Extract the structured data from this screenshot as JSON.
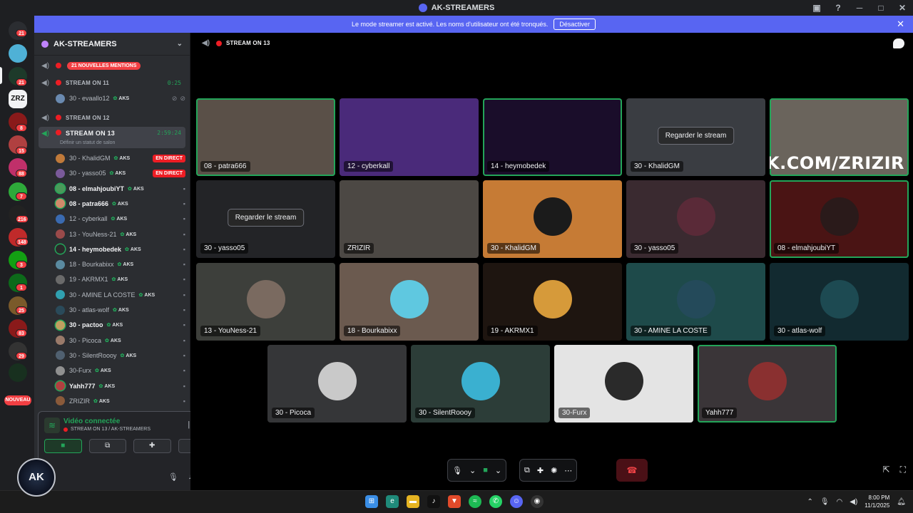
{
  "window": {
    "title": "AK-STREAMERS",
    "controls": [
      "screen-share-icon",
      "help-icon",
      "minimize-icon",
      "maximize-icon",
      "close-icon"
    ]
  },
  "banner": {
    "text": "Le mode streamer est activé. Les noms d'utilisateur ont été tronqués.",
    "button": "Désactiver"
  },
  "rail": {
    "badges": [
      "21",
      "21",
      "8",
      "15",
      "88",
      "7",
      "216",
      "148",
      "3",
      "1",
      "25",
      "83",
      "29"
    ],
    "new_label": "NOUVEAU"
  },
  "server": {
    "name": "AK-STREAMERS"
  },
  "channels": {
    "mentions": "21 NOUVELLES MENTIONS",
    "stream11": {
      "name": "STREAM ON 11",
      "timer": "0:25"
    },
    "stream11_user": {
      "name": "30 - evaallo12",
      "tag": "AKS"
    },
    "stream12": {
      "name": "STREAM ON 12"
    },
    "stream13": {
      "name": "STREAM ON 13",
      "timer": "2:59:24",
      "status": "Définir un statut de salon"
    },
    "live_label": "EN DIRECT",
    "users": [
      {
        "name": "30 - KhalidGM",
        "tag": "AKS",
        "live": true
      },
      {
        "name": "30 - yasso05",
        "tag": "AKS",
        "live": true
      },
      {
        "name": "08 - elmahjoubiYT",
        "tag": "AKS"
      },
      {
        "name": "08 - patra666",
        "tag": "AKS"
      },
      {
        "name": "12 - cyberkall",
        "tag": "AKS"
      },
      {
        "name": "13 - YouNess-21",
        "tag": "AKS"
      },
      {
        "name": "14 - heymobedek",
        "tag": "AKS"
      },
      {
        "name": "18 - Bourkabixx",
        "tag": "AKS"
      },
      {
        "name": "19 - AKRMX1",
        "tag": "AKS"
      },
      {
        "name": "30 - AMINE LA COSTE",
        "tag": "AKS"
      },
      {
        "name": "30 - atlas-wolf",
        "tag": "AKS"
      },
      {
        "name": "30 - pactoo",
        "tag": "AKS"
      },
      {
        "name": "30 - Picoca",
        "tag": "AKS"
      },
      {
        "name": "30 - SilentRoooy",
        "tag": "AKS"
      },
      {
        "name": "30-Furx",
        "tag": "AKS"
      },
      {
        "name": "Yahh777",
        "tag": "AKS"
      },
      {
        "name": "ZRIZIR",
        "tag": "AKS"
      }
    ]
  },
  "voice": {
    "title": "Vidéo connectée",
    "subtitle": "STREAM ON 13 / AK-STREAMERS"
  },
  "logo_text": "AK",
  "stage": {
    "channel": "STREAM ON 13",
    "watch_label": "Regarder le stream",
    "kick_k": "K",
    "kick_rest": "ICK.COM/ZRIZIR",
    "tiles": [
      {
        "label": "08 - patra666",
        "bg": "#5a5048",
        "speaking": true
      },
      {
        "label": "12 - cyberkall",
        "bg": "#4a2a7a",
        "speaking": false
      },
      {
        "label": "14 - heymobedek",
        "bg": "#1a0d2a",
        "speaking": true
      },
      {
        "label": "30 - KhalidGM",
        "bg": "#3a3d42",
        "speaking": false,
        "stream": true
      },
      {
        "label": "",
        "bg": "#6a645c",
        "speaking": true,
        "kick": true
      },
      {
        "label": "30 - yasso05",
        "bg": "#232427",
        "speaking": false,
        "stream": true
      },
      {
        "label": "ZRIZIR",
        "bg": "#4c4844",
        "speaking": false
      },
      {
        "label": "30 - KhalidGM",
        "bg": "#c67b35",
        "speaking": false,
        "avatar": "#1b1b1b"
      },
      {
        "label": "30 - yasso05",
        "bg": "#3a2a30",
        "speaking": false,
        "avatar": "#5a2a38"
      },
      {
        "label": "08 - elmahjoubiYT",
        "bg": "#4a1414",
        "speaking": true,
        "avatar": "#2a1a1a"
      },
      {
        "label": "13 - YouNess-21",
        "bg": "#3d3f3b",
        "speaking": false,
        "avatar": "#7a6a60"
      },
      {
        "label": "18 - Bourkabixx",
        "bg": "#6b5a4f",
        "speaking": false,
        "avatar": "#5fc8e0"
      },
      {
        "label": "19 - AKRMX1",
        "bg": "#1e1510",
        "speaking": false,
        "avatar": "#d69a3a"
      },
      {
        "label": "30 - AMINE LA COSTE",
        "bg": "#1e4a4a",
        "speaking": false,
        "avatar": "#244a5a"
      },
      {
        "label": "30 - atlas-wolf",
        "bg": "#122a30",
        "speaking": false,
        "avatar": "#1d4a52"
      },
      {
        "label": "30 - Picoca",
        "bg": "#353638",
        "speaking": false,
        "avatar": "#c9c9c9"
      },
      {
        "label": "30 - SilentRoooy",
        "bg": "#2c3d38",
        "speaking": false,
        "avatar": "#3ab0d0"
      },
      {
        "label": "30-Furx",
        "bg": "#e4e4e4",
        "speaking": false,
        "avatar": "#2a2a2a"
      },
      {
        "label": "Yahh777",
        "bg": "#3a3538",
        "speaking": true,
        "avatar": "#8a3030"
      }
    ]
  },
  "taskbar": {
    "time": "8:00 PM",
    "date": "11/1/2025"
  },
  "colors": {
    "accent": "#5865f2",
    "live": "#ed1d24",
    "speaking": "#23a559"
  }
}
